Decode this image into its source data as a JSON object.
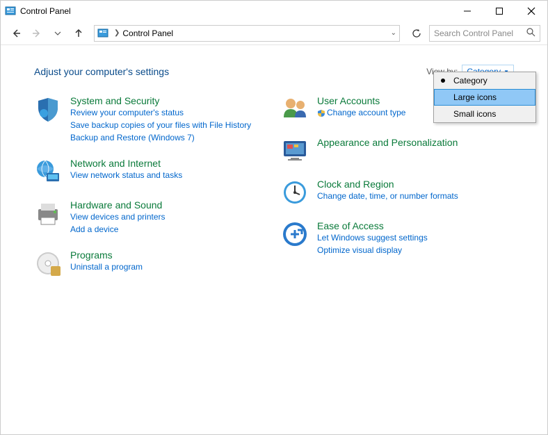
{
  "window": {
    "title": "Control Panel"
  },
  "nav": {
    "address": "Control Panel",
    "search_placeholder": "Search Control Panel"
  },
  "heading": "Adjust your computer's settings",
  "viewby": {
    "label": "View by:",
    "selected": "Category",
    "options": [
      "Category",
      "Large icons",
      "Small icons"
    ],
    "highlighted_index": 1
  },
  "categories_left": [
    {
      "title": "System and Security",
      "links": [
        "Review your computer's status",
        "Save backup copies of your files with File History",
        "Backup and Restore (Windows 7)"
      ]
    },
    {
      "title": "Network and Internet",
      "links": [
        "View network status and tasks"
      ]
    },
    {
      "title": "Hardware and Sound",
      "links": [
        "View devices and printers",
        "Add a device"
      ]
    },
    {
      "title": "Programs",
      "links": [
        "Uninstall a program"
      ]
    }
  ],
  "categories_right": [
    {
      "title": "User Accounts",
      "links": [
        "Change account type"
      ],
      "shield": [
        true
      ]
    },
    {
      "title": "Appearance and Personalization",
      "links": []
    },
    {
      "title": "Clock and Region",
      "links": [
        "Change date, time, or number formats"
      ]
    },
    {
      "title": "Ease of Access",
      "links": [
        "Let Windows suggest settings",
        "Optimize visual display"
      ]
    }
  ]
}
